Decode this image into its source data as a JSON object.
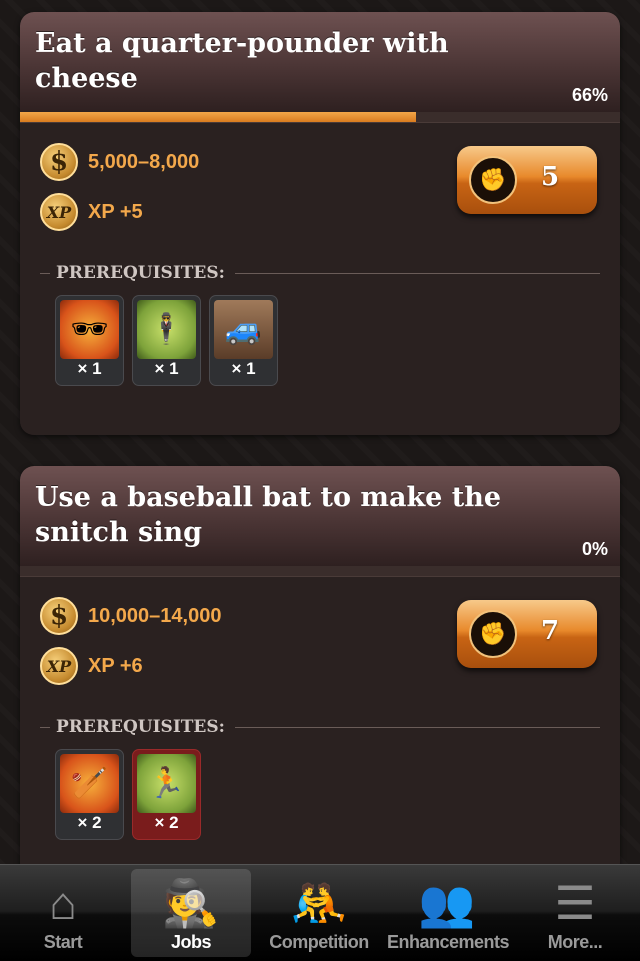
{
  "jobs": [
    {
      "title": "Eat a quarter-pounder with cheese",
      "progress_label": "66%",
      "progress": 0.66,
      "money": "5,000–8,000",
      "xp": "XP +5",
      "energy_cost": "5",
      "prereq_heading": "PREREQUISITES:",
      "prerequisites": [
        {
          "icon": "sunglasses-icon",
          "count": "× 1",
          "met": true
        },
        {
          "icon": "gangster-icon",
          "count": "× 1",
          "met": true
        },
        {
          "icon": "car-icon",
          "count": "× 1",
          "met": true
        }
      ]
    },
    {
      "title": "Use a baseball bat to make the snitch sing",
      "progress_label": "0%",
      "progress": 0,
      "money": "10,000–14,000",
      "xp": "XP +6",
      "energy_cost": "7",
      "prereq_heading": "PREREQUISITES:",
      "prerequisites": [
        {
          "icon": "baseball-bat-icon",
          "count": "× 2",
          "met": true
        },
        {
          "icon": "running-man-icon",
          "count": "× 2",
          "met": false
        }
      ]
    }
  ],
  "tabbar": {
    "tabs": [
      {
        "label": "Start",
        "icon": "house-icon",
        "active": false
      },
      {
        "label": "Jobs",
        "icon": "gangster-gun-icon",
        "active": true
      },
      {
        "label": "Competition",
        "icon": "fight-icon",
        "active": false
      },
      {
        "label": "Enhancements",
        "icon": "gunmen-icon",
        "active": false
      },
      {
        "label": "More...",
        "icon": "list-icon",
        "active": false
      }
    ]
  },
  "colors": {
    "accent": "#f3a84b",
    "progress": "#e8892b",
    "missing": "#7a1c1c"
  }
}
